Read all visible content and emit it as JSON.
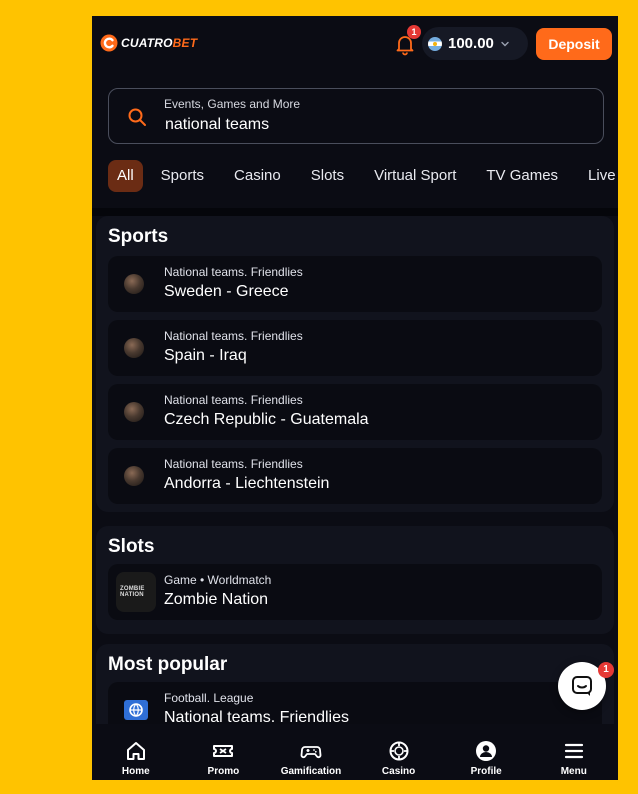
{
  "header": {
    "logo_part1": "CUATRO",
    "logo_part2": "BET",
    "notification_count": "1",
    "balance": "100.00",
    "deposit_label": "Deposit"
  },
  "search": {
    "label": "Events, Games and More",
    "value": "national teams"
  },
  "tabs": [
    {
      "label": "All",
      "active": true
    },
    {
      "label": "Sports"
    },
    {
      "label": "Casino"
    },
    {
      "label": "Slots"
    },
    {
      "label": "Virtual Sport"
    },
    {
      "label": "TV Games"
    },
    {
      "label": "Live"
    }
  ],
  "sports": {
    "title": "Sports",
    "items": [
      {
        "league": "National teams. Friendlies",
        "match": "Sweden - Greece"
      },
      {
        "league": "National teams. Friendlies",
        "match": "Spain - Iraq"
      },
      {
        "league": "National teams. Friendlies",
        "match": "Czech Republic - Guatemala"
      },
      {
        "league": "National teams. Friendlies",
        "match": "Andorra - Liechtenstein"
      }
    ]
  },
  "slots": {
    "title": "Slots",
    "items": [
      {
        "meta": "Game • Worldmatch",
        "name": "Zombie Nation",
        "thumb_text": "ZOMBIE NATION"
      }
    ]
  },
  "popular": {
    "title": "Most popular",
    "items": [
      {
        "meta": "Football. League",
        "name": "National teams. Friendlies"
      }
    ]
  },
  "chat": {
    "badge": "1"
  },
  "bottom_nav": [
    {
      "label": "Home",
      "icon": "home-icon"
    },
    {
      "label": "Promo",
      "icon": "ticket-icon"
    },
    {
      "label": "Gamification",
      "icon": "gamepad-icon"
    },
    {
      "label": "Casino",
      "icon": "chip-icon"
    },
    {
      "label": "Profile",
      "icon": "user-icon"
    },
    {
      "label": "Menu",
      "icon": "menu-icon"
    }
  ],
  "colors": {
    "background": "#ffc300",
    "app_bg": "#0b0c14",
    "accent": "#ff6a1a",
    "active_tab": "#6b2c14",
    "badge": "#e53935"
  }
}
